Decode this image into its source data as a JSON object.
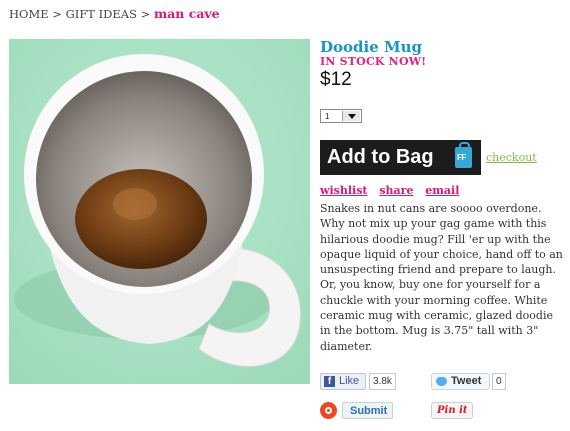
{
  "breadcrumb": {
    "home": "HOME",
    "separator": ">",
    "gift_ideas": "GIFT IDEAS",
    "current": "man cave"
  },
  "product": {
    "title": "Doodie Mug",
    "stock_status": "IN STOCK NOW!",
    "price": "$12",
    "quantity": "1",
    "add_to_bag_label": "Add to Bag",
    "bag_icon_text": "FF",
    "checkout_label": "checkout",
    "links": {
      "wishlist": "wishlist",
      "share": "share",
      "email": "email"
    },
    "description": "Snakes in nut cans are soooo overdone. Why not mix up your gag game with this hilarious doodie mug? Fill 'er up with the opaque liquid of your choice, hand off to an unsuspecting friend and prepare to laugh. Or, you know, buy one for yourself for a chuckle with your morning coffee. White ceramic mug with ceramic, glazed doodie in the bottom. Mug is 3.75\" tall with 3\" diameter."
  },
  "social": {
    "facebook_label": "Like",
    "facebook_count": "3.8k",
    "twitter_label": "Tweet",
    "twitter_count": "0",
    "stumbleupon_label": "Submit",
    "pinterest_label": "Pin it"
  },
  "colors": {
    "title": "#1b92c9",
    "accent_pink": "#d6187a",
    "checkout_green": "#7fbf3f",
    "photo_background": "#a7e1c2",
    "add_to_bag_bg": "#1c1c1c"
  }
}
